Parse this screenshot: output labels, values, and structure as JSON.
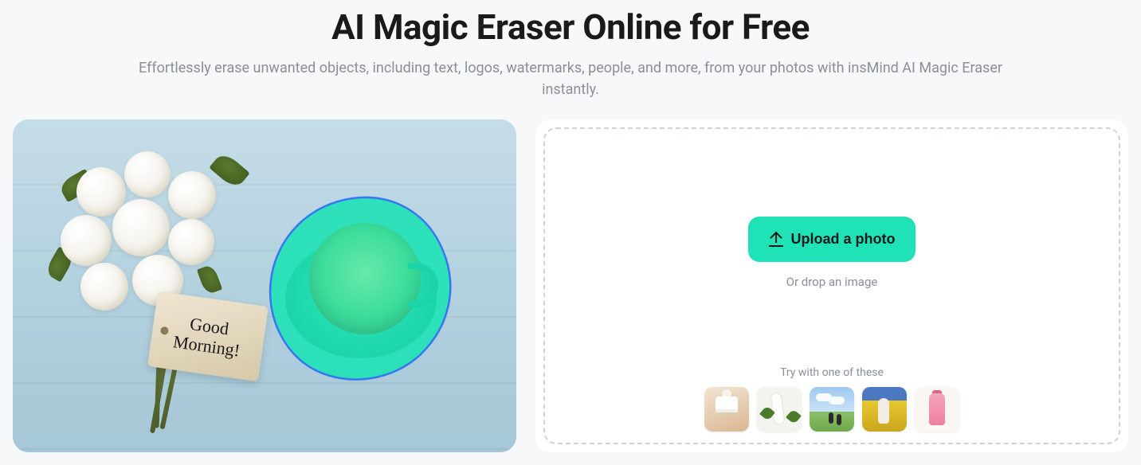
{
  "header": {
    "title": "AI Magic Eraser Online for Free",
    "subtitle": "Effortlessly erase unwanted objects, including text, logos, watermarks, people, and more, from your photos with insMind AI Magic Eraser instantly."
  },
  "preview": {
    "tag_text": "Good Morning!",
    "description": "demo-image-flowers-coffee",
    "selection_icon": "eraser-selection"
  },
  "upload": {
    "button_label": "Upload a photo",
    "drop_hint": "Or drop an image",
    "samples_label": "Try with one of these",
    "upload_icon": "upload-arrow-icon",
    "samples": [
      {
        "name": "sample-cosmetic-jar"
      },
      {
        "name": "sample-skincare-tube"
      },
      {
        "name": "sample-sky-field"
      },
      {
        "name": "sample-flower-field-person"
      },
      {
        "name": "sample-pink-bottle"
      }
    ]
  },
  "colors": {
    "accent": "#1fe3b7",
    "selection_stroke": "#2a6df4",
    "text_muted": "#8a8f98"
  }
}
